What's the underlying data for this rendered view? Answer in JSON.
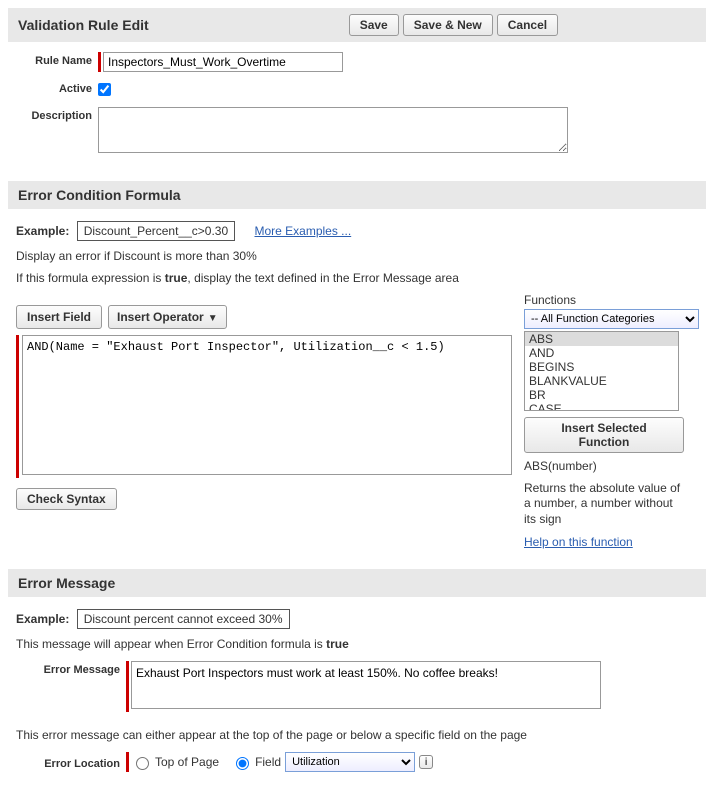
{
  "header": {
    "title": "Validation Rule Edit",
    "save": "Save",
    "save_new": "Save & New",
    "cancel": "Cancel"
  },
  "form": {
    "rule_name_label": "Rule Name",
    "rule_name_value": "Inspectors_Must_Work_Overtime",
    "active_label": "Active",
    "active_checked": true,
    "description_label": "Description",
    "description_value": ""
  },
  "formula_section": {
    "title": "Error Condition Formula",
    "example_label": "Example:",
    "example_value": "Discount_Percent__c>0.30",
    "more_examples": "More Examples ...",
    "example_desc": "Display an error if Discount is more than 30%",
    "if_line_pre": "If this formula expression is ",
    "if_line_bold": "true",
    "if_line_post": ", display the text defined in the Error Message area",
    "insert_field": "Insert Field",
    "insert_operator": "Insert Operator",
    "formula_value": "AND(Name = \"Exhaust Port Inspector\", Utilization__c < 1.5)",
    "check_syntax": "Check Syntax"
  },
  "functions": {
    "title": "Functions",
    "category_selected": "-- All Function Categories",
    "list": [
      "ABS",
      "AND",
      "BEGINS",
      "BLANKVALUE",
      "BR",
      "CASE"
    ],
    "selected_index": 0,
    "insert_selected": "Insert Selected Function",
    "sig": "ABS(number)",
    "desc": "Returns the absolute value of a number, a number without its sign",
    "help_link": "Help on this function"
  },
  "error_message_section": {
    "title": "Error Message",
    "example_label": "Example:",
    "example_value": "Discount percent cannot exceed 30%",
    "appear_line_pre": "This message will appear when Error Condition formula is ",
    "appear_line_bold": "true",
    "error_message_label": "Error Message",
    "error_message_value": "Exhaust Port Inspectors must work at least 150%. No coffee breaks!",
    "location_note": "This error message can either appear at the top of the page or below a specific field on the page",
    "error_location_label": "Error Location",
    "top_of_page": "Top of Page",
    "field_label": "Field",
    "field_selected": "Utilization"
  }
}
